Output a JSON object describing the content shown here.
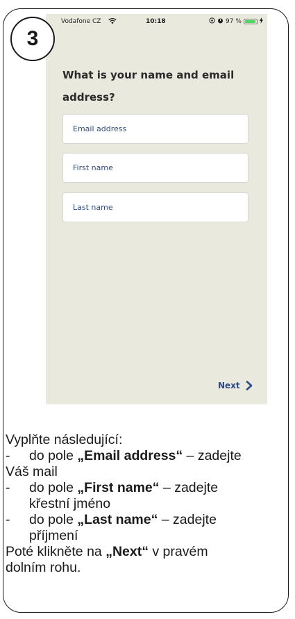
{
  "step_number": "3",
  "status_bar": {
    "carrier": "Vodafone CZ",
    "time": "10:18",
    "battery": "97 %"
  },
  "form": {
    "question": "What is your name and email address?",
    "email_placeholder": "Email address",
    "first_name_placeholder": "First name",
    "last_name_placeholder": "Last name",
    "next_label": "Next"
  },
  "instructions": {
    "intro": "Vyplňte následující:",
    "item1_dash": "-",
    "item1_pre": "do pole ",
    "item1_field": "„Email address“",
    "item1_post": " – zadejte",
    "item1_cont": "Váš mail",
    "item2_dash": "-",
    "item2_pre": "do pole ",
    "item2_field": "„First name“",
    "item2_post": " – zadejte",
    "item2_cont": "křestní jméno",
    "item3_dash": "-",
    "item3_pre": "do pole ",
    "item3_field": "„Last name“",
    "item3_post": " – zadejte",
    "item3_cont": "příjmení",
    "outro_pre": "Poté klikněte na ",
    "outro_bold": "„Next“",
    "outro_post": " v pravém",
    "outro_cont": "dolním rohu."
  },
  "colors": {
    "phone_background": "#eae9de",
    "accent_blue": "#2f4a88"
  }
}
